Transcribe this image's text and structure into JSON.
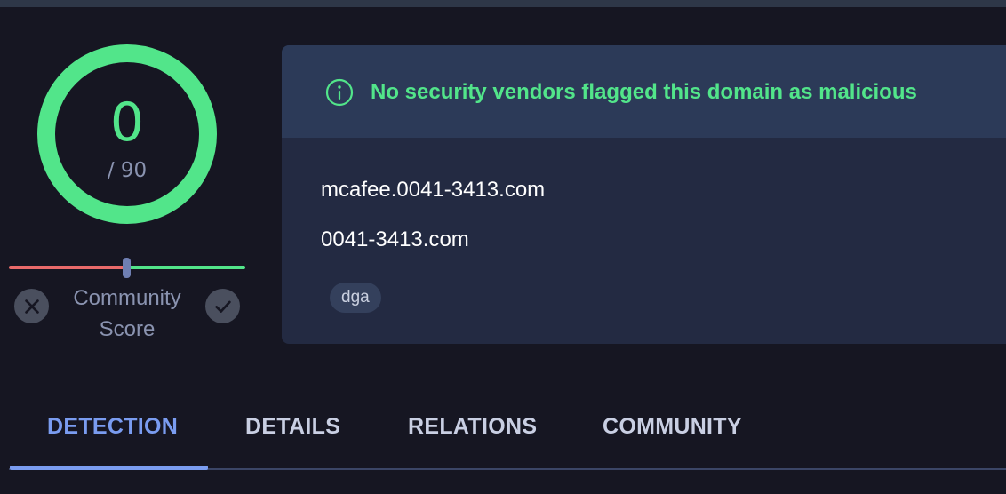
{
  "score": {
    "value": "0",
    "total": "/ 90",
    "color": "#52e58a"
  },
  "community": {
    "label_line1": "Community",
    "label_line2": "Score",
    "downvote_icon": "close-icon",
    "upvote_icon": "check-icon"
  },
  "card": {
    "header_icon": "info-icon",
    "header_text": "No security vendors flagged this domain as malicious",
    "domains": [
      "mcafee.0041-3413.com",
      "0041-3413.com"
    ],
    "tags": [
      "dga"
    ]
  },
  "tabs": [
    {
      "label": "DETECTION",
      "active": true
    },
    {
      "label": "DETAILS",
      "active": false
    },
    {
      "label": "RELATIONS",
      "active": false
    },
    {
      "label": "COMMUNITY",
      "active": false
    }
  ],
  "colors": {
    "accent": "#7a9cf0",
    "success": "#52e58a",
    "danger": "#e96a6a"
  }
}
